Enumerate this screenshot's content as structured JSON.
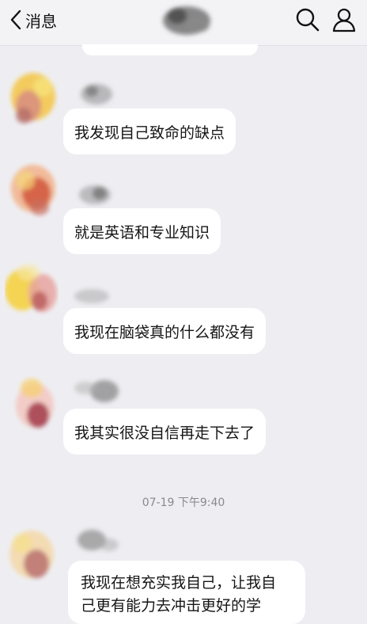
{
  "header": {
    "back_label": "消息",
    "back_icon": "chevron-left-icon",
    "search_icon": "search-icon",
    "profile_icon": "person-icon"
  },
  "messages": [
    {
      "text": "我发现自己致命的缺点"
    },
    {
      "text": "就是英语和专业知识"
    },
    {
      "text": "我现在脑袋真的什么都没有"
    },
    {
      "text": "我其实很没自信再走下去了"
    }
  ],
  "timestamp": "07-19 下午9:40",
  "last_message": {
    "line1": "我现在想充实我自己，让我自",
    "line2": "己更有能力去冲击更好的学"
  },
  "colors": {
    "background": "#eeeef2",
    "bubble": "#ffffff",
    "text": "#151515",
    "timestamp": "#8a8a8e"
  }
}
